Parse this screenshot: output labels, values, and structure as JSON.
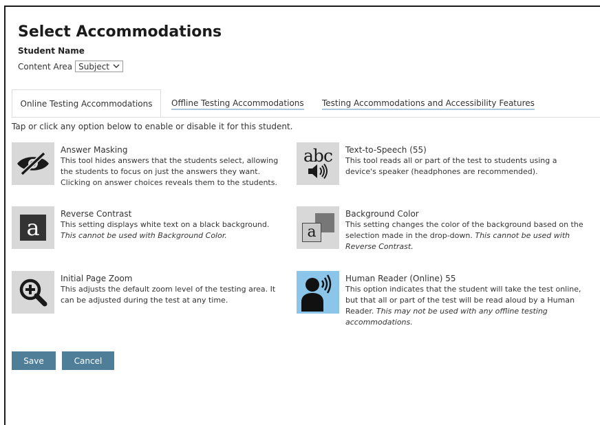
{
  "header": {
    "title": "Select Accommodations",
    "student_label": "Student Name",
    "content_area_label": "Content Area",
    "content_area_value": "Subject"
  },
  "tabs": [
    {
      "label": "Online Testing Accommodations",
      "active": true
    },
    {
      "label": "Offline Testing Accommodations",
      "active": false
    },
    {
      "label": "Testing Accommodations and Accessibility Features",
      "active": false
    }
  ],
  "instructions": "Tap or click any option below to enable or disable it for this student.",
  "accommodations": [
    {
      "icon": "eye-slash-icon",
      "title": "Answer Masking",
      "desc": "This tool hides answers that the students select, allowing the students to focus on just the answers they want. Clicking on answer choices reveals them to the students.",
      "note": ""
    },
    {
      "icon": "text-to-speech-icon",
      "title": "Text-to-Speech (55)",
      "desc": "This tool reads all or part of the test to students using a device's speaker (headphones are recommended).",
      "note": ""
    },
    {
      "icon": "reverse-contrast-icon",
      "title": "Reverse Contrast",
      "desc": "This setting displays white text on a black background.",
      "note": "This cannot be used with Background Color."
    },
    {
      "icon": "background-color-icon",
      "title": "Background Color",
      "desc": "This setting changes the color of the background based on the selection made in the drop-down.",
      "note": "This cannot be used with Reverse Contrast."
    },
    {
      "icon": "zoom-in-icon",
      "title": "Initial Page Zoom",
      "desc": "This adjusts the default zoom level of the testing area. It can be adjusted during the test at any time.",
      "note": ""
    },
    {
      "icon": "human-reader-icon",
      "title": "Human Reader (Online) 55",
      "desc": "This option indicates that the student will take the test online, but that all or part of the test will be read aloud by a Human Reader.",
      "note": "This may not be used with any offline testing accommodations."
    }
  ],
  "icon_glyphs": {
    "reverse_contrast": "a",
    "background_color": "a",
    "text_to_speech": "abc"
  },
  "buttons": {
    "save": "Save",
    "cancel": "Cancel"
  },
  "colors": {
    "button": "#4f7e99",
    "icon_bg": "#d8d8d8",
    "human_reader_bg": "#8cc5ea",
    "tab_underline": "#a9c8e0"
  }
}
